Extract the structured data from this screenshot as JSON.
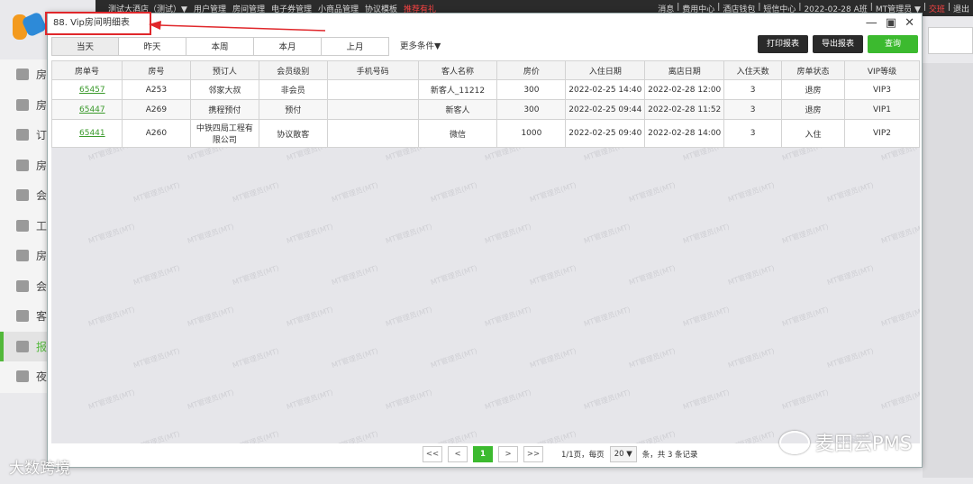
{
  "topbar": {
    "menu": [
      "测试大酒店（测试）▼",
      "用户管理",
      "房间管理",
      "电子券管理",
      "小商品管理",
      "协议模板",
      "推荐有礼"
    ],
    "right": [
      "消息",
      "费用中心",
      "酒店钱包",
      "短信中心",
      "2022-02-28 A班",
      "MT管理员 ▼",
      "交班",
      "退出"
    ]
  },
  "sidebar": {
    "items": [
      {
        "label": "房"
      },
      {
        "label": "房"
      },
      {
        "label": "订"
      },
      {
        "label": "房"
      },
      {
        "label": "会"
      },
      {
        "label": "工"
      },
      {
        "label": "房"
      },
      {
        "label": "会"
      },
      {
        "label": "客"
      },
      {
        "label": "报"
      },
      {
        "label": "夜"
      }
    ]
  },
  "modal": {
    "title": "88. Vip房间明细表",
    "tabs": [
      "当天",
      "昨天",
      "本周",
      "本月",
      "上月"
    ],
    "more_conditions": "更多条件▼",
    "buttons": {
      "print": "打印报表",
      "export": "导出报表",
      "query": "查询"
    },
    "columns": [
      "房单号",
      "房号",
      "预订人",
      "会员级别",
      "手机号码",
      "客人名称",
      "房价",
      "入住日期",
      "离店日期",
      "入住天数",
      "房单状态",
      "VIP等级"
    ],
    "rows": [
      {
        "order": "65457",
        "room": "A253",
        "booker": "邻家大叔",
        "member": "非会员",
        "phone": "",
        "guest": "新客人_11212",
        "price": "300",
        "checkin": "2022-02-25 14:40",
        "checkout": "2022-02-28 12:00",
        "days": "3",
        "status": "退房",
        "vip": "VIP3"
      },
      {
        "order": "65447",
        "room": "A269",
        "booker": "携程预付",
        "member": "预付",
        "phone": "",
        "guest": "新客人",
        "price": "300",
        "checkin": "2022-02-25 09:44",
        "checkout": "2022-02-28 11:52",
        "days": "3",
        "status": "退房",
        "vip": "VIP1"
      },
      {
        "order": "65441",
        "room": "A260",
        "booker": "中铁四局工程有限公司",
        "member": "协议散客",
        "phone": "",
        "guest": "微信",
        "price": "1000",
        "checkin": "2022-02-25 09:40",
        "checkout": "2022-02-28 14:00",
        "days": "3",
        "status": "入住",
        "vip": "VIP2"
      }
    ],
    "pager": {
      "first": "<<",
      "prev": "<",
      "current": "1",
      "next": ">",
      "last": ">>",
      "info": "1/1页，每页",
      "page_size": "20 ▼",
      "records": "条，共 3 条记录"
    }
  },
  "watermark_text": "MT管理员(MT)",
  "overlays": {
    "wechat": "麦田云PMS",
    "corner": "大数跨境"
  },
  "colors": {
    "accent": "#3cba2f",
    "highlight": "#e0272b",
    "link": "#3a9a2b"
  }
}
